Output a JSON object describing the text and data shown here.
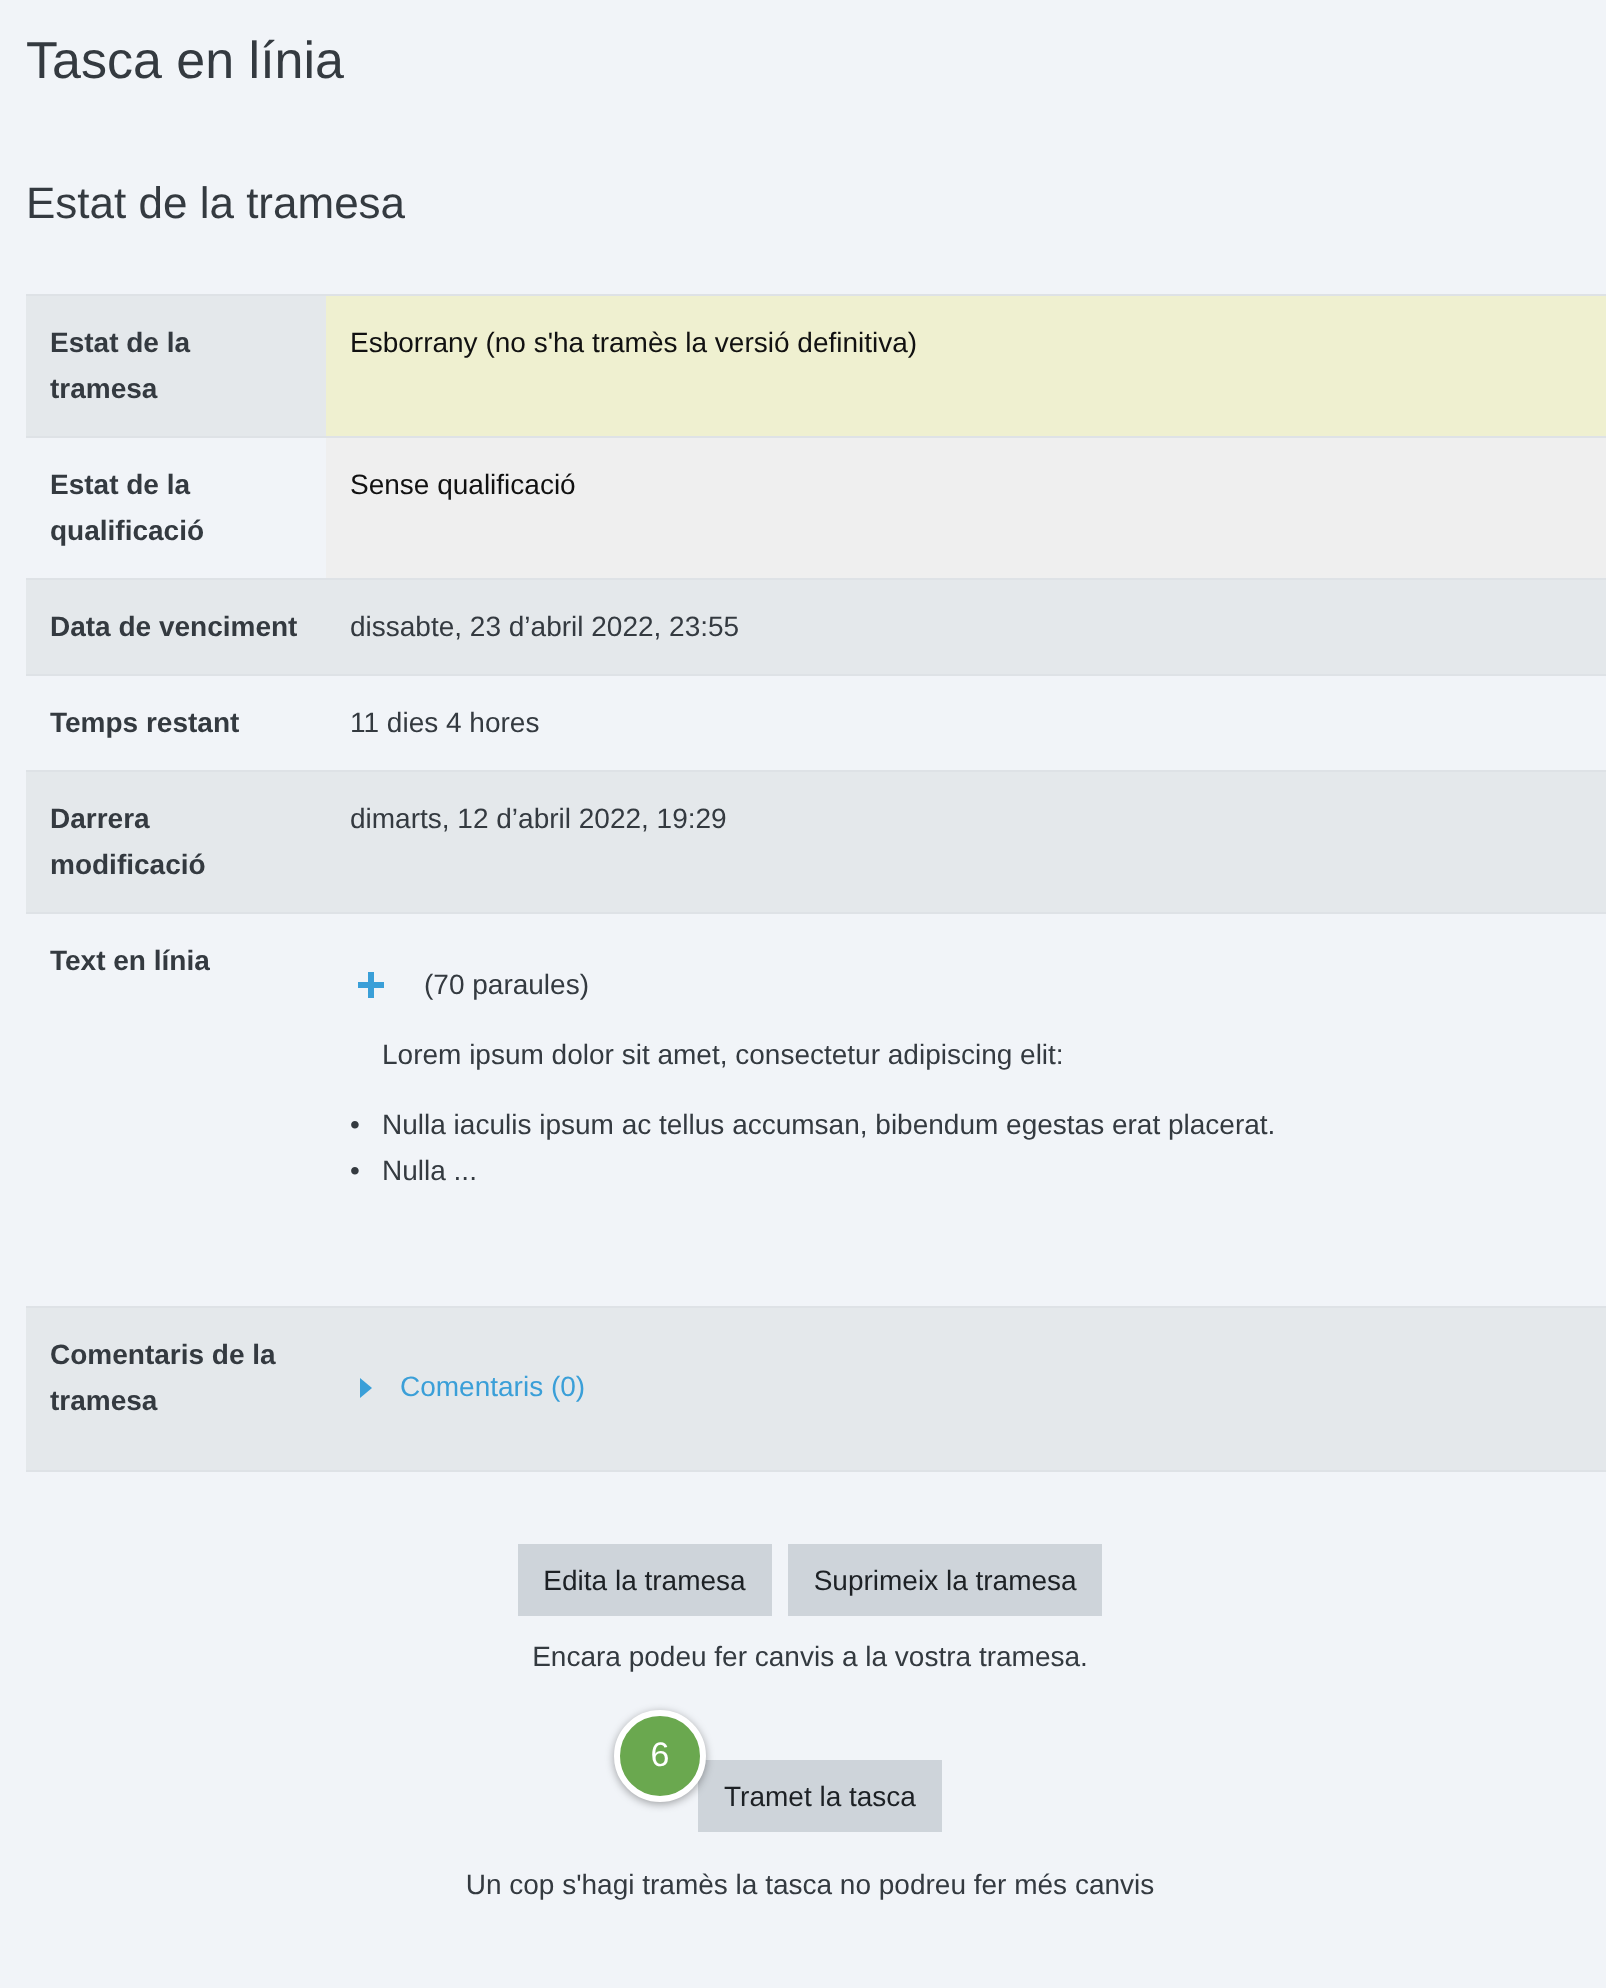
{
  "page_title": "Tasca en línia",
  "section_title": "Estat de la tramesa",
  "rows": [
    {
      "kind": "submission",
      "label": "Estat de la tramesa",
      "value": "Esborrany (no s'ha tramès la versió definitiva)"
    },
    {
      "kind": "grading",
      "label": "Estat de la qualificació",
      "value": "Sense qualificació"
    },
    {
      "kind": "plain",
      "label": "Data de venciment",
      "value": "dissabte, 23 d’abril 2022, 23:55"
    },
    {
      "kind": "plain",
      "label": "Temps restant",
      "value": "11 dies 4 hores"
    },
    {
      "kind": "plain",
      "label": "Darrera modificació",
      "value": "dimarts, 12 d’abril 2022, 19:29"
    },
    {
      "kind": "onlinetext",
      "label": "Text en línia",
      "word_count": "(70 paraules)",
      "intro": "Lorem ipsum dolor sit amet, consectetur adipiscing elit:",
      "bullets": [
        {
          "marker": "•",
          "text": "Nulla iaculis ipsum ac tellus accumsan, bibendum egestas erat placerat."
        },
        {
          "marker": "•",
          "text": "Nulla ..."
        }
      ]
    },
    {
      "kind": "comments",
      "label": "Comentaris de la tramesa",
      "link": "Comentaris (0)",
      "expanded": false
    }
  ],
  "actions": [
    "Edita la tramesa",
    "Suprimeix la tramesa"
  ],
  "actions_note": "Encara podeu fer canvis a la vostra tramesa.",
  "step_badge": "6",
  "submit_button": "Tramet la tasca",
  "submit_note": "Un cop s'hagi tramès la tasca no podreu fer més canvis"
}
